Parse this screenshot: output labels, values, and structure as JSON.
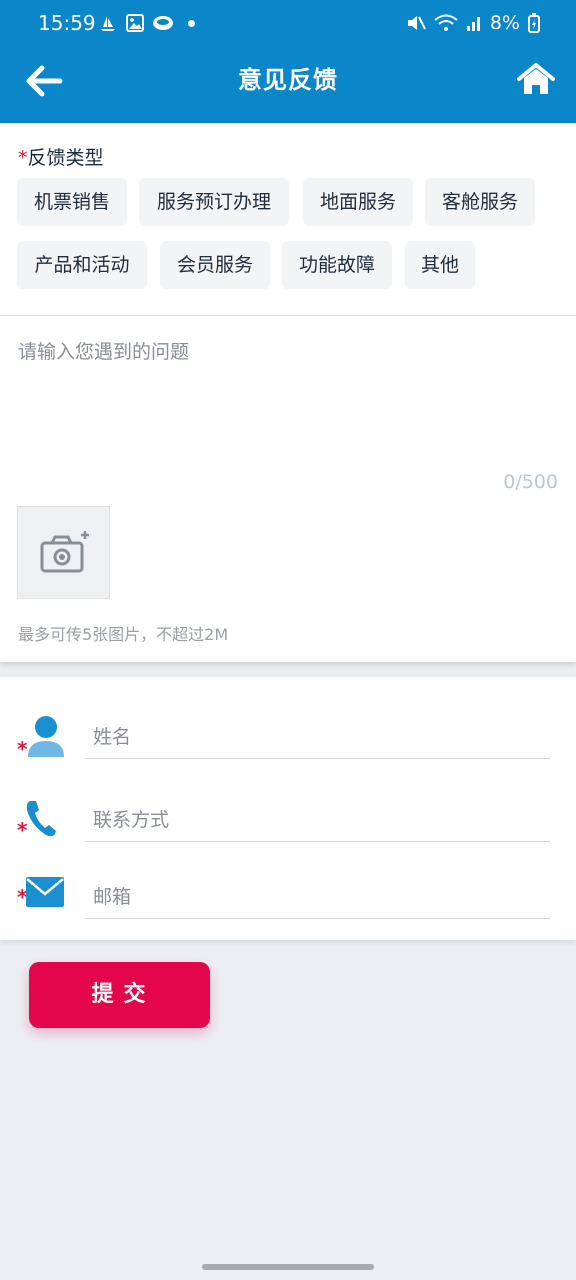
{
  "status_bar": {
    "time": "15:59",
    "battery": "8%"
  },
  "header": {
    "title": "意见反馈"
  },
  "feedback": {
    "required_mark": "*",
    "type_label": "反馈类型",
    "types": [
      {
        "label": "机票销售"
      },
      {
        "label": "服务预订办理"
      },
      {
        "label": "地面服务"
      },
      {
        "label": "客舱服务"
      },
      {
        "label": "产品和活动"
      },
      {
        "label": "会员服务"
      },
      {
        "label": "功能故障"
      },
      {
        "label": "其他"
      }
    ],
    "problem_placeholder": "请输入您遇到的问题",
    "counter": "0/500",
    "photo_hint": "最多可传5张图片，不超过2M"
  },
  "contact": {
    "name_placeholder": "姓名",
    "phone_placeholder": "联系方式",
    "email_placeholder": "邮箱",
    "required_mark": "*"
  },
  "submit": {
    "label": "提交"
  },
  "colors": {
    "brand_blue": "#0a86c9",
    "accent_red": "#e3064a",
    "icon_blue": "#1a8fd0"
  }
}
